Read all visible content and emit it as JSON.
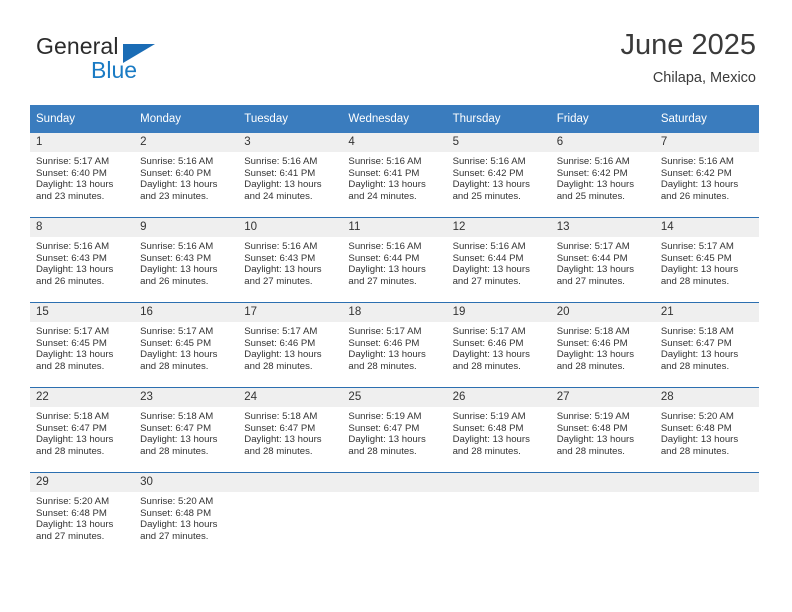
{
  "brand": {
    "name_part1": "General",
    "name_part2": "Blue",
    "triangle_color": "#1a6cb5",
    "blue_color": "#1a7bc4"
  },
  "header": {
    "title": "June 2025",
    "subtitle": "Chilapa, Mexico"
  },
  "theme": {
    "header_bg": "#3a7cbe",
    "row_divider": "#2c6fb0",
    "daynum_bg": "#efefef",
    "text": "#333333"
  },
  "weekdays": [
    "Sunday",
    "Monday",
    "Tuesday",
    "Wednesday",
    "Thursday",
    "Friday",
    "Saturday"
  ],
  "weeks": [
    [
      {
        "day": "1",
        "sunrise": "Sunrise: 5:17 AM",
        "sunset": "Sunset: 6:40 PM",
        "daylight_line1": "Daylight: 13 hours",
        "daylight_line2": "and 23 minutes."
      },
      {
        "day": "2",
        "sunrise": "Sunrise: 5:16 AM",
        "sunset": "Sunset: 6:40 PM",
        "daylight_line1": "Daylight: 13 hours",
        "daylight_line2": "and 23 minutes."
      },
      {
        "day": "3",
        "sunrise": "Sunrise: 5:16 AM",
        "sunset": "Sunset: 6:41 PM",
        "daylight_line1": "Daylight: 13 hours",
        "daylight_line2": "and 24 minutes."
      },
      {
        "day": "4",
        "sunrise": "Sunrise: 5:16 AM",
        "sunset": "Sunset: 6:41 PM",
        "daylight_line1": "Daylight: 13 hours",
        "daylight_line2": "and 24 minutes."
      },
      {
        "day": "5",
        "sunrise": "Sunrise: 5:16 AM",
        "sunset": "Sunset: 6:42 PM",
        "daylight_line1": "Daylight: 13 hours",
        "daylight_line2": "and 25 minutes."
      },
      {
        "day": "6",
        "sunrise": "Sunrise: 5:16 AM",
        "sunset": "Sunset: 6:42 PM",
        "daylight_line1": "Daylight: 13 hours",
        "daylight_line2": "and 25 minutes."
      },
      {
        "day": "7",
        "sunrise": "Sunrise: 5:16 AM",
        "sunset": "Sunset: 6:42 PM",
        "daylight_line1": "Daylight: 13 hours",
        "daylight_line2": "and 26 minutes."
      }
    ],
    [
      {
        "day": "8",
        "sunrise": "Sunrise: 5:16 AM",
        "sunset": "Sunset: 6:43 PM",
        "daylight_line1": "Daylight: 13 hours",
        "daylight_line2": "and 26 minutes."
      },
      {
        "day": "9",
        "sunrise": "Sunrise: 5:16 AM",
        "sunset": "Sunset: 6:43 PM",
        "daylight_line1": "Daylight: 13 hours",
        "daylight_line2": "and 26 minutes."
      },
      {
        "day": "10",
        "sunrise": "Sunrise: 5:16 AM",
        "sunset": "Sunset: 6:43 PM",
        "daylight_line1": "Daylight: 13 hours",
        "daylight_line2": "and 27 minutes."
      },
      {
        "day": "11",
        "sunrise": "Sunrise: 5:16 AM",
        "sunset": "Sunset: 6:44 PM",
        "daylight_line1": "Daylight: 13 hours",
        "daylight_line2": "and 27 minutes."
      },
      {
        "day": "12",
        "sunrise": "Sunrise: 5:16 AM",
        "sunset": "Sunset: 6:44 PM",
        "daylight_line1": "Daylight: 13 hours",
        "daylight_line2": "and 27 minutes."
      },
      {
        "day": "13",
        "sunrise": "Sunrise: 5:17 AM",
        "sunset": "Sunset: 6:44 PM",
        "daylight_line1": "Daylight: 13 hours",
        "daylight_line2": "and 27 minutes."
      },
      {
        "day": "14",
        "sunrise": "Sunrise: 5:17 AM",
        "sunset": "Sunset: 6:45 PM",
        "daylight_line1": "Daylight: 13 hours",
        "daylight_line2": "and 28 minutes."
      }
    ],
    [
      {
        "day": "15",
        "sunrise": "Sunrise: 5:17 AM",
        "sunset": "Sunset: 6:45 PM",
        "daylight_line1": "Daylight: 13 hours",
        "daylight_line2": "and 28 minutes."
      },
      {
        "day": "16",
        "sunrise": "Sunrise: 5:17 AM",
        "sunset": "Sunset: 6:45 PM",
        "daylight_line1": "Daylight: 13 hours",
        "daylight_line2": "and 28 minutes."
      },
      {
        "day": "17",
        "sunrise": "Sunrise: 5:17 AM",
        "sunset": "Sunset: 6:46 PM",
        "daylight_line1": "Daylight: 13 hours",
        "daylight_line2": "and 28 minutes."
      },
      {
        "day": "18",
        "sunrise": "Sunrise: 5:17 AM",
        "sunset": "Sunset: 6:46 PM",
        "daylight_line1": "Daylight: 13 hours",
        "daylight_line2": "and 28 minutes."
      },
      {
        "day": "19",
        "sunrise": "Sunrise: 5:17 AM",
        "sunset": "Sunset: 6:46 PM",
        "daylight_line1": "Daylight: 13 hours",
        "daylight_line2": "and 28 minutes."
      },
      {
        "day": "20",
        "sunrise": "Sunrise: 5:18 AM",
        "sunset": "Sunset: 6:46 PM",
        "daylight_line1": "Daylight: 13 hours",
        "daylight_line2": "and 28 minutes."
      },
      {
        "day": "21",
        "sunrise": "Sunrise: 5:18 AM",
        "sunset": "Sunset: 6:47 PM",
        "daylight_line1": "Daylight: 13 hours",
        "daylight_line2": "and 28 minutes."
      }
    ],
    [
      {
        "day": "22",
        "sunrise": "Sunrise: 5:18 AM",
        "sunset": "Sunset: 6:47 PM",
        "daylight_line1": "Daylight: 13 hours",
        "daylight_line2": "and 28 minutes."
      },
      {
        "day": "23",
        "sunrise": "Sunrise: 5:18 AM",
        "sunset": "Sunset: 6:47 PM",
        "daylight_line1": "Daylight: 13 hours",
        "daylight_line2": "and 28 minutes."
      },
      {
        "day": "24",
        "sunrise": "Sunrise: 5:18 AM",
        "sunset": "Sunset: 6:47 PM",
        "daylight_line1": "Daylight: 13 hours",
        "daylight_line2": "and 28 minutes."
      },
      {
        "day": "25",
        "sunrise": "Sunrise: 5:19 AM",
        "sunset": "Sunset: 6:47 PM",
        "daylight_line1": "Daylight: 13 hours",
        "daylight_line2": "and 28 minutes."
      },
      {
        "day": "26",
        "sunrise": "Sunrise: 5:19 AM",
        "sunset": "Sunset: 6:48 PM",
        "daylight_line1": "Daylight: 13 hours",
        "daylight_line2": "and 28 minutes."
      },
      {
        "day": "27",
        "sunrise": "Sunrise: 5:19 AM",
        "sunset": "Sunset: 6:48 PM",
        "daylight_line1": "Daylight: 13 hours",
        "daylight_line2": "and 28 minutes."
      },
      {
        "day": "28",
        "sunrise": "Sunrise: 5:20 AM",
        "sunset": "Sunset: 6:48 PM",
        "daylight_line1": "Daylight: 13 hours",
        "daylight_line2": "and 28 minutes."
      }
    ],
    [
      {
        "day": "29",
        "sunrise": "Sunrise: 5:20 AM",
        "sunset": "Sunset: 6:48 PM",
        "daylight_line1": "Daylight: 13 hours",
        "daylight_line2": "and 27 minutes."
      },
      {
        "day": "30",
        "sunrise": "Sunrise: 5:20 AM",
        "sunset": "Sunset: 6:48 PM",
        "daylight_line1": "Daylight: 13 hours",
        "daylight_line2": "and 27 minutes."
      },
      {
        "day": "",
        "sunrise": "",
        "sunset": "",
        "daylight_line1": "",
        "daylight_line2": ""
      },
      {
        "day": "",
        "sunrise": "",
        "sunset": "",
        "daylight_line1": "",
        "daylight_line2": ""
      },
      {
        "day": "",
        "sunrise": "",
        "sunset": "",
        "daylight_line1": "",
        "daylight_line2": ""
      },
      {
        "day": "",
        "sunrise": "",
        "sunset": "",
        "daylight_line1": "",
        "daylight_line2": ""
      },
      {
        "day": "",
        "sunrise": "",
        "sunset": "",
        "daylight_line1": "",
        "daylight_line2": ""
      }
    ]
  ]
}
